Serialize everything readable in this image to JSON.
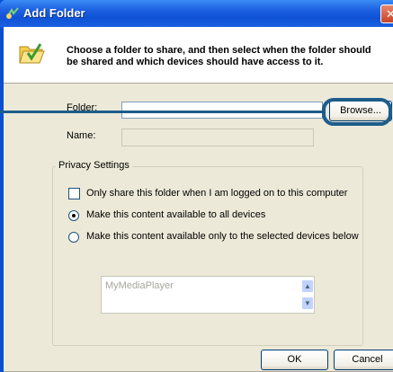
{
  "window": {
    "title": "Add Folder",
    "close_glyph": "✕",
    "colors": {
      "titlebar": "#1f63e3",
      "client": "#ece9d8",
      "callout": "#1d5d8c"
    }
  },
  "header": {
    "instruction": "Choose a folder to share, and then select when the folder should be shared and which devices should have access to it.",
    "icon": "folder-check-icon"
  },
  "form": {
    "folder_label": "Folder:",
    "folder_value": "",
    "browse_label": "Browse...",
    "name_label": "Name:",
    "name_value": ""
  },
  "privacy": {
    "group_title": "Privacy Settings",
    "checkbox_label": "Only share this folder when I am logged on to this computer",
    "checkbox_checked": false,
    "radio_all_label": "Make this content available to all devices",
    "radio_selected_label": "Make this content available only to the selected devices below",
    "selected_radio": "all",
    "devices": [
      "MyMediaPlayer"
    ]
  },
  "footer": {
    "ok_label": "OK",
    "cancel_label": "Cancel"
  }
}
